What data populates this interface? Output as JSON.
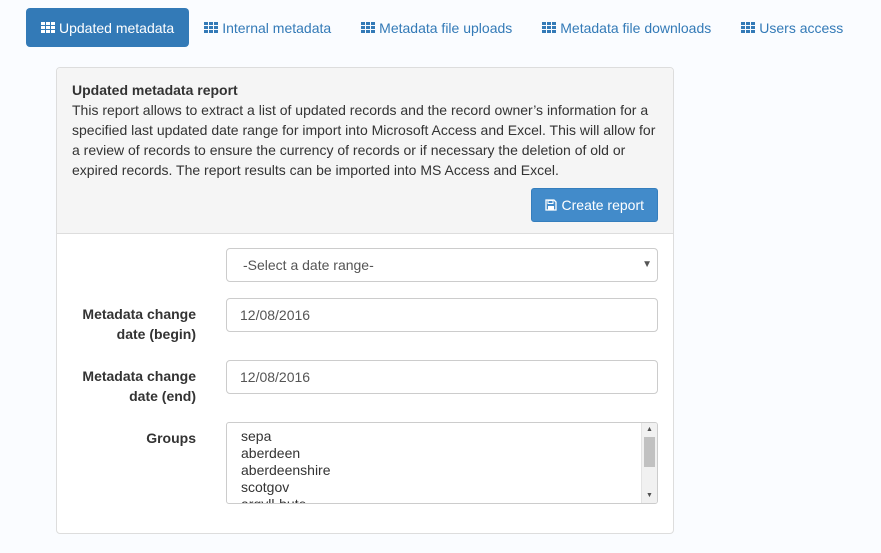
{
  "tabs": [
    {
      "label": "Updated metadata",
      "active": true,
      "icon": "th-grid-icon"
    },
    {
      "label": "Internal metadata",
      "active": false,
      "icon": "th-grid-icon"
    },
    {
      "label": "Metadata file uploads",
      "active": false,
      "icon": "th-grid-icon"
    },
    {
      "label": "Metadata file downloads",
      "active": false,
      "icon": "th-grid-icon"
    },
    {
      "label": "Users access",
      "active": false,
      "icon": "th-grid-icon"
    }
  ],
  "report": {
    "title": "Updated metadata report",
    "description_lines": [
      "This report allows to extract a list of updated records and the record owner’s information for a",
      "specified last updated date range for import into Microsoft Access and Excel. This will allow for",
      "a review of records to ensure the currency of records or if necessary the deletion of old or",
      "expired records. The report results can be imported into MS Access and Excel."
    ],
    "create_button": "Create report",
    "create_icon": "floppy-disk-icon"
  },
  "form": {
    "date_range": {
      "selected": "-Select a date range-"
    },
    "begin": {
      "label_lines": [
        "Metadata change",
        "date (begin)"
      ],
      "value": "12/08/2016"
    },
    "end": {
      "label_lines": [
        "Metadata change",
        "date (end)"
      ],
      "value": "12/08/2016"
    },
    "groups": {
      "label": "Groups",
      "options": [
        "sepa",
        "aberdeen",
        "aberdeenshire",
        "scotgov",
        "argyll-bute"
      ]
    }
  },
  "colors": {
    "accent": "#337ab7",
    "button": "#428bca",
    "panel_heading": "#f5f5f5",
    "page_bg": "#fafcff"
  }
}
